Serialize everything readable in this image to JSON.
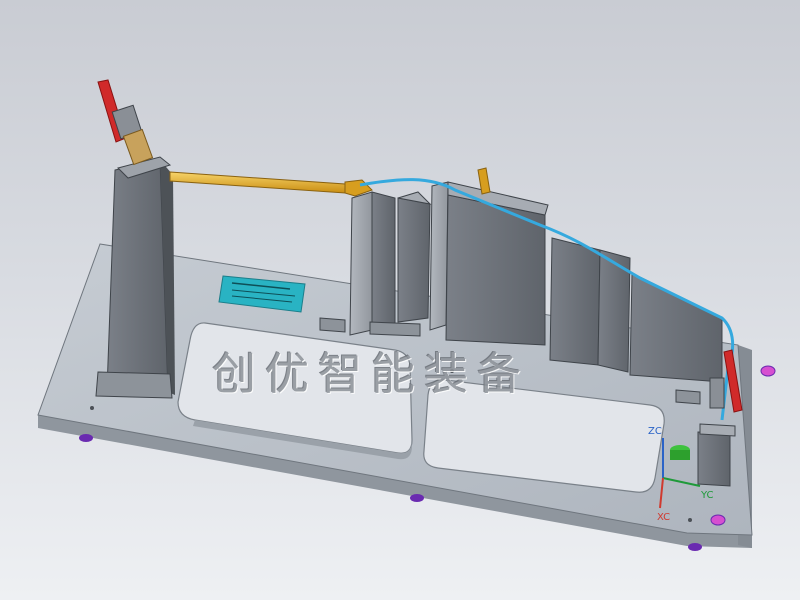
{
  "watermark": {
    "text": "创优智能装备"
  },
  "triad": {
    "z_label": "ZC",
    "y_label": "YC",
    "x_label": "XC",
    "z_color": "#2a63c7",
    "y_color": "#1f9a3a",
    "x_color": "#d03a2f"
  },
  "colors": {
    "base_plate": "#b9c0c8",
    "rod": "#e9b22a",
    "clamp_handle": "#d02a2a",
    "nameplate": "#29b3c3",
    "wire": "#35a9de",
    "feet": "#6a2bb0"
  },
  "icons": [
    "rotation-axis-triad-icon",
    "toggle-clamp-icon",
    "nameplate-icon"
  ]
}
